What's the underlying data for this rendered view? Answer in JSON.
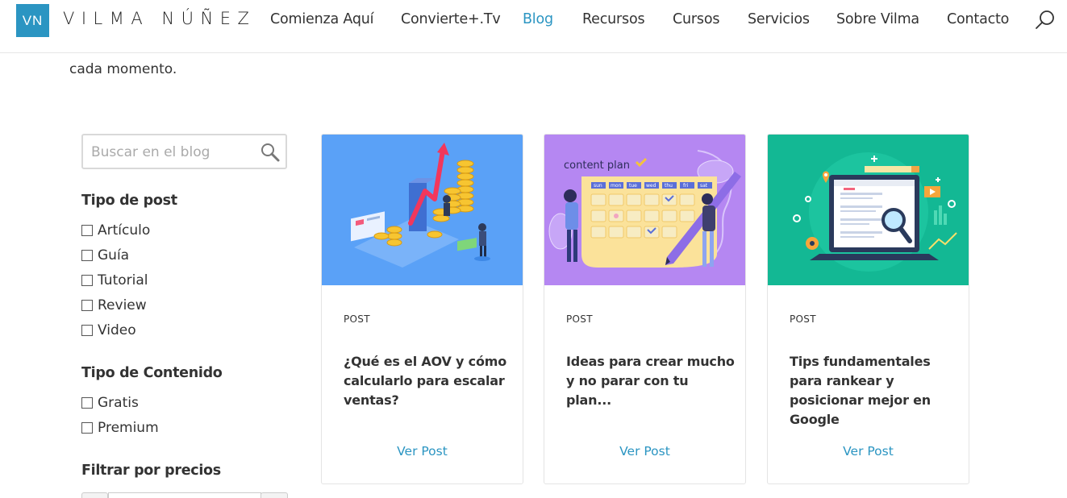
{
  "header": {
    "logo_mark": "VN",
    "logo_text": "VILMA NÚÑEZ",
    "nav": [
      {
        "label": "Comienza Aquí",
        "active": false
      },
      {
        "label": "Convierte+.Tv",
        "active": false
      },
      {
        "label": "Blog",
        "active": true
      },
      {
        "label": "Recursos",
        "active": false
      },
      {
        "label": "Cursos",
        "active": false
      },
      {
        "label": "Servicios",
        "active": false
      },
      {
        "label": "Sobre Vilma",
        "active": false
      },
      {
        "label": "Contacto",
        "active": false
      }
    ],
    "search_icon": "search-icon"
  },
  "intro_text": "cada momento.",
  "sidebar": {
    "search": {
      "placeholder": "Buscar en el blog",
      "value": ""
    },
    "post_type": {
      "heading": "Tipo de post",
      "options": [
        "Artículo",
        "Guía",
        "Tutorial",
        "Review",
        "Video"
      ]
    },
    "content_type": {
      "heading": "Tipo de Contenido",
      "options": [
        "Gratis",
        "Premium"
      ]
    },
    "price_filter": {
      "heading": "Filtrar por precios"
    }
  },
  "cards": [
    {
      "tag": "POST",
      "title": "¿Qué es el AOV y cómo calcularlo para escalar ventas?",
      "link": "Ver Post",
      "image_bg": "#5aa1f7"
    },
    {
      "tag": "POST",
      "title": "Ideas para crear mucho y no parar con tu plan...",
      "link": "Ver Post",
      "image_bg": "#b587f2",
      "image_text": "content plan",
      "image_days": [
        "sun",
        "mon",
        "tue",
        "wed",
        "thu",
        "fri",
        "sat"
      ]
    },
    {
      "tag": "POST",
      "title": "Tips fundamentales para rankear y posicionar mejor en Google",
      "link": "Ver Post",
      "image_bg": "#13b894"
    }
  ],
  "colors": {
    "accent": "#2b95c2"
  }
}
